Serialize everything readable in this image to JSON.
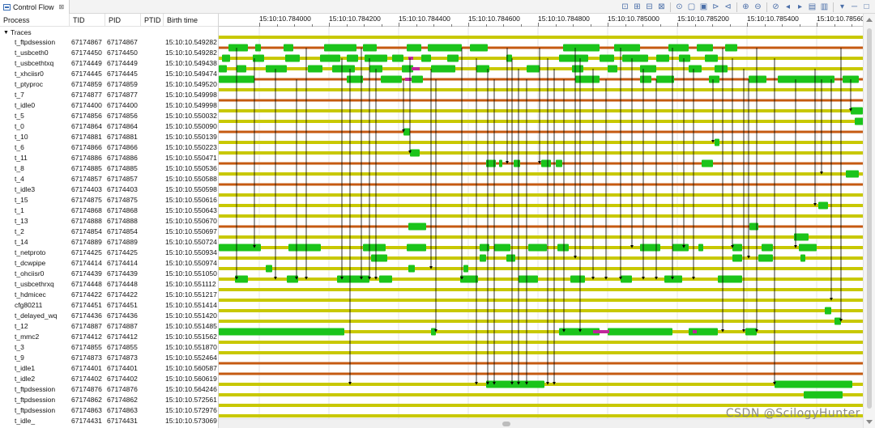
{
  "view": {
    "tab_title": "Control Flow",
    "tab_close": "⊠",
    "toolbar_icons": [
      "align-views-icon",
      "timestamp-icon",
      "show-legend-icon",
      "filter-icon",
      "lock-icon",
      "previous-event-icon",
      "next-event-icon",
      "previous-marker-icon",
      "next-marker-icon",
      "zoom-in-icon",
      "zoom-out-icon",
      "hide-arrows-icon",
      "follow-cpu-backward-icon",
      "follow-cpu-forward-icon",
      "add-bookmark-icon",
      "next-bookmark-icon",
      "view-menu-icon",
      "minimize-icon",
      "maximize-icon"
    ]
  },
  "tree": {
    "columns": [
      "Process",
      "TID",
      "PID",
      "PTID",
      "Birth time"
    ],
    "root_label": "Traces",
    "rows": [
      {
        "name": "t_ftpdsession",
        "tid": "67174867",
        "pid": "67174867",
        "ptid": "",
        "birth": "15:10:10.549282"
      },
      {
        "name": "t_usbceth0",
        "tid": "67174450",
        "pid": "67174450",
        "ptid": "",
        "birth": "15:10:10.549282"
      },
      {
        "name": "t_usbcethtxq",
        "tid": "67174449",
        "pid": "67174449",
        "ptid": "",
        "birth": "15:10:10.549438"
      },
      {
        "name": "t_xhciisr0",
        "tid": "67174445",
        "pid": "67174445",
        "ptid": "",
        "birth": "15:10:10.549474"
      },
      {
        "name": "t_ptyproc",
        "tid": "67174859",
        "pid": "67174859",
        "ptid": "",
        "birth": "15:10:10.549520"
      },
      {
        "name": "t_7",
        "tid": "67174877",
        "pid": "67174877",
        "ptid": "",
        "birth": "15:10:10.549998"
      },
      {
        "name": "t_idle0",
        "tid": "67174400",
        "pid": "67174400",
        "ptid": "",
        "birth": "15:10:10.549998"
      },
      {
        "name": "t_5",
        "tid": "67174856",
        "pid": "67174856",
        "ptid": "",
        "birth": "15:10:10.550032"
      },
      {
        "name": "t_0",
        "tid": "67174864",
        "pid": "67174864",
        "ptid": "",
        "birth": "15:10:10.550090"
      },
      {
        "name": "t_10",
        "tid": "67174881",
        "pid": "67174881",
        "ptid": "",
        "birth": "15:10:10.550139"
      },
      {
        "name": "t_6",
        "tid": "67174866",
        "pid": "67174866",
        "ptid": "",
        "birth": "15:10:10.550223"
      },
      {
        "name": "t_11",
        "tid": "67174886",
        "pid": "67174886",
        "ptid": "",
        "birth": "15:10:10.550471"
      },
      {
        "name": "t_8",
        "tid": "67174885",
        "pid": "67174885",
        "ptid": "",
        "birth": "15:10:10.550536"
      },
      {
        "name": "t_4",
        "tid": "67174857",
        "pid": "67174857",
        "ptid": "",
        "birth": "15:10:10.550588"
      },
      {
        "name": "t_idle3",
        "tid": "67174403",
        "pid": "67174403",
        "ptid": "",
        "birth": "15:10:10.550598"
      },
      {
        "name": "t_15",
        "tid": "67174875",
        "pid": "67174875",
        "ptid": "",
        "birth": "15:10:10.550616"
      },
      {
        "name": "t_1",
        "tid": "67174868",
        "pid": "67174868",
        "ptid": "",
        "birth": "15:10:10.550643"
      },
      {
        "name": "t_13",
        "tid": "67174888",
        "pid": "67174888",
        "ptid": "",
        "birth": "15:10:10.550670"
      },
      {
        "name": "t_2",
        "tid": "67174854",
        "pid": "67174854",
        "ptid": "",
        "birth": "15:10:10.550697"
      },
      {
        "name": "t_14",
        "tid": "67174889",
        "pid": "67174889",
        "ptid": "",
        "birth": "15:10:10.550724"
      },
      {
        "name": "t_netproto",
        "tid": "67174425",
        "pid": "67174425",
        "ptid": "",
        "birth": "15:10:10.550934"
      },
      {
        "name": "t_dcwpipe",
        "tid": "67174414",
        "pid": "67174414",
        "ptid": "",
        "birth": "15:10:10.550974"
      },
      {
        "name": "t_ohciisr0",
        "tid": "67174439",
        "pid": "67174439",
        "ptid": "",
        "birth": "15:10:10.551050"
      },
      {
        "name": "t_usbcethrxq",
        "tid": "67174448",
        "pid": "67174448",
        "ptid": "",
        "birth": "15:10:10.551112"
      },
      {
        "name": "t_hdmicec",
        "tid": "67174422",
        "pid": "67174422",
        "ptid": "",
        "birth": "15:10:10.551217"
      },
      {
        "name": "cfg80211",
        "tid": "67174451",
        "pid": "67174451",
        "ptid": "",
        "birth": "15:10:10.551414"
      },
      {
        "name": "t_delayed_wq",
        "tid": "67174436",
        "pid": "67174436",
        "ptid": "",
        "birth": "15:10:10.551420"
      },
      {
        "name": "t_12",
        "tid": "67174887",
        "pid": "67174887",
        "ptid": "",
        "birth": "15:10:10.551485"
      },
      {
        "name": "t_mmc2",
        "tid": "67174412",
        "pid": "67174412",
        "ptid": "",
        "birth": "15:10:10.551562"
      },
      {
        "name": "t_3",
        "tid": "67174855",
        "pid": "67174855",
        "ptid": "",
        "birth": "15:10:10.551870"
      },
      {
        "name": "t_9",
        "tid": "67174873",
        "pid": "67174873",
        "ptid": "",
        "birth": "15:10:10.552464"
      },
      {
        "name": "t_idle1",
        "tid": "67174401",
        "pid": "67174401",
        "ptid": "",
        "birth": "15:10:10.560587"
      },
      {
        "name": "t_idle2",
        "tid": "67174402",
        "pid": "67174402",
        "ptid": "",
        "birth": "15:10:10.560619"
      },
      {
        "name": "t_ftpdsession",
        "tid": "67174876",
        "pid": "67174876",
        "ptid": "",
        "birth": "15:10:10.564246"
      },
      {
        "name": "t_ftpdsession",
        "tid": "67174862",
        "pid": "67174862",
        "ptid": "",
        "birth": "15:10:10.572561"
      },
      {
        "name": "t_ftpdsession",
        "tid": "67174863",
        "pid": "67174863",
        "ptid": "",
        "birth": "15:10:10.572976"
      },
      {
        "name": "t_idle_",
        "tid": "67174431",
        "pid": "67174431",
        "ptid": "",
        "birth": "15:10:10.573069"
      }
    ]
  },
  "timeline": {
    "ruler_labels": [
      "15:10:10.784000",
      "15:10:10.784200",
      "15:10:10.784400",
      "15:10:10.784600",
      "15:10:10.784800",
      "15:10:10.785000",
      "15:10:10.785200",
      "15:10:10.785400",
      "15:10:10.785600"
    ],
    "colors": {
      "wait": "#c8c800",
      "running": "#1bc41b",
      "blocked": "#c55a11",
      "preempted": "#c0279a",
      "arrow": "#000000",
      "grid": "#e6e6e6"
    },
    "state_kinds": [
      "wait",
      "blocked",
      "wait",
      "wait",
      "blocked",
      "wait",
      "blocked",
      "wait",
      "wait",
      "blocked",
      "wait",
      "wait",
      "blocked",
      "wait",
      "blocked",
      "wait",
      "wait",
      "wait",
      "blocked",
      "wait",
      "wait",
      "wait",
      "wait",
      "wait",
      "wait",
      "wait",
      "wait",
      "wait",
      "wait",
      "wait",
      "wait",
      "blocked",
      "blocked",
      "wait",
      "wait",
      "wait",
      "wait"
    ],
    "running_segments": [
      [
        0,
        1040,
        1060
      ],
      [
        1,
        12,
        36
      ],
      [
        1,
        45,
        52
      ],
      [
        1,
        80,
        92
      ],
      [
        1,
        130,
        170
      ],
      [
        1,
        178,
        195
      ],
      [
        1,
        232,
        250
      ],
      [
        1,
        258,
        300
      ],
      [
        1,
        310,
        332
      ],
      [
        1,
        425,
        470
      ],
      [
        1,
        488,
        520
      ],
      [
        1,
        555,
        580
      ],
      [
        1,
        590,
        610
      ],
      [
        1,
        625,
        640
      ],
      [
        2,
        4,
        14
      ],
      [
        2,
        42,
        56
      ],
      [
        2,
        82,
        100
      ],
      [
        2,
        125,
        150
      ],
      [
        2,
        158,
        172
      ],
      [
        2,
        180,
        208
      ],
      [
        2,
        214,
        228
      ],
      [
        2,
        250,
        262
      ],
      [
        2,
        282,
        296
      ],
      [
        2,
        355,
        362
      ],
      [
        2,
        420,
        456
      ],
      [
        2,
        470,
        488
      ],
      [
        2,
        498,
        530
      ],
      [
        2,
        540,
        556
      ],
      [
        2,
        568,
        582
      ],
      [
        2,
        600,
        616
      ],
      [
        3,
        0,
        10
      ],
      [
        3,
        22,
        34
      ],
      [
        3,
        58,
        84
      ],
      [
        3,
        110,
        128
      ],
      [
        3,
        140,
        168
      ],
      [
        3,
        186,
        202
      ],
      [
        3,
        226,
        240
      ],
      [
        3,
        262,
        292
      ],
      [
        3,
        318,
        334
      ],
      [
        3,
        380,
        396
      ],
      [
        3,
        436,
        450
      ],
      [
        3,
        480,
        492
      ],
      [
        3,
        520,
        540
      ],
      [
        3,
        580,
        596
      ],
      [
        3,
        612,
        628
      ],
      [
        4,
        0,
        44
      ],
      [
        4,
        158,
        178
      ],
      [
        4,
        200,
        226
      ],
      [
        4,
        238,
        252
      ],
      [
        4,
        440,
        470
      ],
      [
        4,
        520,
        534
      ],
      [
        4,
        540,
        562
      ],
      [
        4,
        605,
        618
      ],
      [
        4,
        654,
        676
      ],
      [
        4,
        690,
        760
      ],
      [
        4,
        770,
        790
      ],
      [
        7,
        780,
        795
      ],
      [
        8,
        785,
        800
      ],
      [
        9,
        228,
        236
      ],
      [
        10,
        612,
        618
      ],
      [
        11,
        236,
        248
      ],
      [
        12,
        330,
        342
      ],
      [
        12,
        346,
        350
      ],
      [
        12,
        364,
        372
      ],
      [
        12,
        398,
        410
      ],
      [
        12,
        416,
        424
      ],
      [
        12,
        596,
        610
      ],
      [
        13,
        774,
        790
      ],
      [
        16,
        740,
        752
      ],
      [
        18,
        234,
        256
      ],
      [
        18,
        655,
        666
      ],
      [
        19,
        710,
        728
      ],
      [
        20,
        0,
        52
      ],
      [
        20,
        86,
        126
      ],
      [
        20,
        178,
        206
      ],
      [
        20,
        232,
        256
      ],
      [
        20,
        322,
        334
      ],
      [
        20,
        340,
        360
      ],
      [
        20,
        382,
        405
      ],
      [
        20,
        418,
        432
      ],
      [
        20,
        520,
        545
      ],
      [
        20,
        560,
        580
      ],
      [
        20,
        592,
        598
      ],
      [
        20,
        634,
        646
      ],
      [
        20,
        670,
        684
      ],
      [
        20,
        716,
        738
      ],
      [
        21,
        188,
        208
      ],
      [
        21,
        322,
        330
      ],
      [
        21,
        355,
        366
      ],
      [
        21,
        634,
        646
      ],
      [
        21,
        666,
        684
      ],
      [
        21,
        718,
        724
      ],
      [
        22,
        58,
        66
      ],
      [
        22,
        234,
        242
      ],
      [
        22,
        302,
        308
      ],
      [
        23,
        20,
        36
      ],
      [
        23,
        84,
        98
      ],
      [
        23,
        146,
        186
      ],
      [
        23,
        198,
        214
      ],
      [
        23,
        298,
        320
      ],
      [
        23,
        370,
        394
      ],
      [
        23,
        434,
        452
      ],
      [
        23,
        496,
        510
      ],
      [
        23,
        550,
        572
      ],
      [
        23,
        616,
        646
      ],
      [
        26,
        748,
        756
      ],
      [
        27,
        760,
        768
      ],
      [
        28,
        0,
        155
      ],
      [
        28,
        262,
        268
      ],
      [
        28,
        420,
        470
      ],
      [
        28,
        480,
        560
      ],
      [
        28,
        580,
        616
      ],
      [
        28,
        650,
        664
      ],
      [
        33,
        330,
        402
      ],
      [
        33,
        686,
        782
      ],
      [
        34,
        722,
        770
      ]
    ],
    "preempted_segments": [
      [
        2,
        234,
        240
      ],
      [
        3,
        238,
        248
      ],
      [
        4,
        230,
        238
      ],
      [
        28,
        462,
        482
      ],
      [
        28,
        585,
        590
      ]
    ],
    "arrows": [
      [
        1,
        22,
        23,
        22
      ],
      [
        2,
        44,
        20,
        44
      ],
      [
        3,
        70,
        23,
        70
      ],
      [
        4,
        96,
        23,
        96
      ],
      [
        1,
        108,
        23,
        108
      ],
      [
        2,
        152,
        23,
        152
      ],
      [
        3,
        162,
        33,
        162
      ],
      [
        1,
        176,
        23,
        176
      ],
      [
        2,
        186,
        23,
        186
      ],
      [
        3,
        194,
        23,
        194
      ],
      [
        4,
        228,
        9,
        228
      ],
      [
        2,
        236,
        11,
        236
      ],
      [
        3,
        262,
        22,
        262
      ],
      [
        4,
        268,
        28,
        268
      ],
      [
        1,
        300,
        23,
        300
      ],
      [
        2,
        318,
        33,
        318
      ],
      [
        3,
        332,
        33,
        332
      ],
      [
        4,
        340,
        33,
        340
      ],
      [
        1,
        356,
        12,
        356
      ],
      [
        2,
        362,
        33,
        362
      ],
      [
        3,
        370,
        33,
        370
      ],
      [
        4,
        380,
        33,
        380
      ],
      [
        1,
        396,
        12,
        396
      ],
      [
        2,
        406,
        33,
        406
      ],
      [
        3,
        414,
        33,
        414
      ],
      [
        4,
        426,
        28,
        426
      ],
      [
        1,
        440,
        21,
        440
      ],
      [
        2,
        446,
        28,
        446
      ],
      [
        3,
        462,
        23,
        462
      ],
      [
        4,
        478,
        23,
        478
      ],
      [
        1,
        496,
        23,
        496
      ],
      [
        2,
        510,
        20,
        510
      ],
      [
        3,
        524,
        23,
        524
      ],
      [
        4,
        540,
        23,
        540
      ],
      [
        1,
        560,
        23,
        560
      ],
      [
        2,
        574,
        20,
        574
      ],
      [
        3,
        586,
        23,
        586
      ],
      [
        4,
        610,
        10,
        610
      ],
      [
        1,
        622,
        28,
        622
      ],
      [
        2,
        634,
        20,
        634
      ],
      [
        3,
        648,
        28,
        648
      ],
      [
        4,
        654,
        21,
        654
      ],
      [
        1,
        664,
        28,
        664
      ],
      [
        2,
        686,
        33,
        686
      ],
      [
        4,
        712,
        20,
        712
      ],
      [
        3,
        736,
        16,
        736
      ],
      [
        4,
        744,
        13,
        744
      ],
      [
        4,
        756,
        25,
        756
      ],
      [
        1,
        768,
        27,
        768
      ],
      [
        4,
        780,
        7,
        780
      ]
    ]
  },
  "watermark": "CSDN @ScilogyHunter"
}
